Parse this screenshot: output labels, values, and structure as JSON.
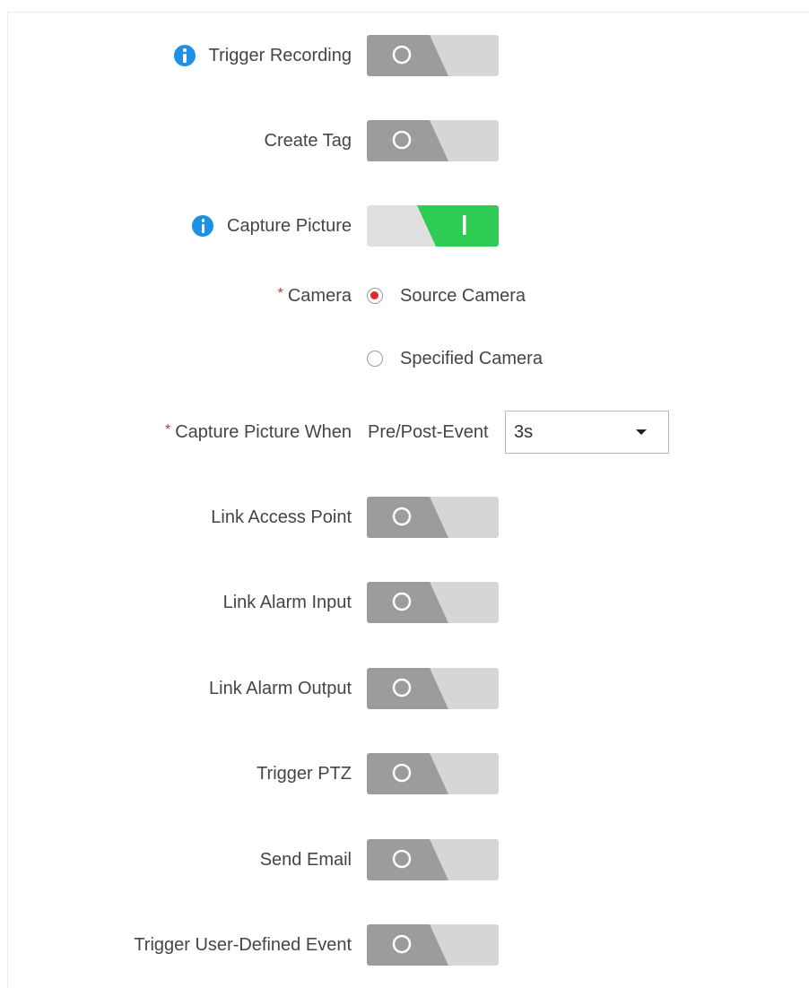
{
  "form": {
    "trigger_recording": {
      "label": "Trigger Recording",
      "enabled": false,
      "info_icon": "info-icon"
    },
    "create_tag": {
      "label": "Create Tag",
      "enabled": false
    },
    "capture_picture": {
      "label": "Capture Picture",
      "enabled": true,
      "info_icon": "info-icon"
    },
    "camera": {
      "label": "Camera",
      "required_mark": "*",
      "options": [
        {
          "label": "Source Camera",
          "selected": true
        },
        {
          "label": "Specified Camera",
          "selected": false
        }
      ]
    },
    "capture_picture_when": {
      "label": "Capture Picture When",
      "required_mark": "*",
      "prefix_text": "Pre/Post-Event",
      "selected_value": "3s"
    },
    "link_access_point": {
      "label": "Link Access Point",
      "enabled": false
    },
    "link_alarm_input": {
      "label": "Link Alarm Input",
      "enabled": false
    },
    "link_alarm_output": {
      "label": "Link Alarm Output",
      "enabled": false
    },
    "trigger_ptz": {
      "label": "Trigger PTZ",
      "enabled": false
    },
    "send_email": {
      "label": "Send Email",
      "enabled": false
    },
    "trigger_user_defined_event": {
      "label": "Trigger User-Defined Event",
      "enabled": false
    }
  },
  "colors": {
    "toggle_off_dark": "#9c9c9c",
    "toggle_off_light": "#d6d6d6",
    "toggle_on_green": "#2ecc52",
    "toggle_on_light": "#e0e0e0",
    "info_blue": "#1e90e6",
    "required_red": "#e02a2a",
    "radio_selected_red": "#e8262a"
  }
}
